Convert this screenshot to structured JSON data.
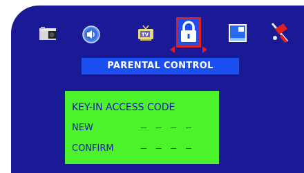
{
  "menu": {
    "icons": [
      {
        "name": "camera-icon"
      },
      {
        "name": "speaker-icon"
      },
      {
        "name": "tv-icon"
      },
      {
        "name": "lock-icon",
        "selected": true
      },
      {
        "name": "picture-window-icon"
      },
      {
        "name": "tools-icon"
      }
    ],
    "selected_index": 3
  },
  "title": "PARENTAL CONTROL",
  "panel": {
    "heading": "KEY-IN ACCESS CODE",
    "new_label": "NEW",
    "new_value": "— — — —",
    "confirm_label": "CONFIRM",
    "confirm_value": "— — — —"
  },
  "colors": {
    "background": "#1a1a96",
    "title_bar": "#1c4ff0",
    "panel": "#4cf22c",
    "panel_text": "#1a1aa0",
    "selection": "#e02020"
  }
}
